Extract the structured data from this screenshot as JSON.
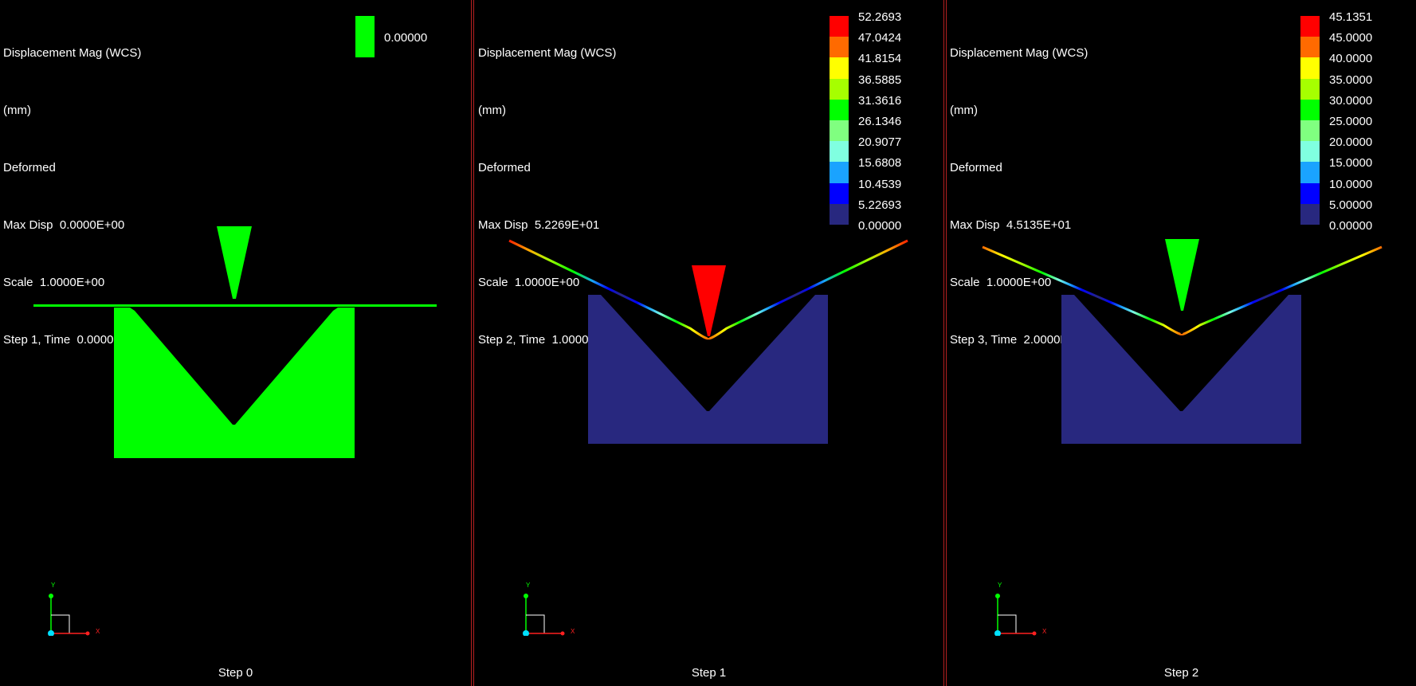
{
  "viewports": [
    {
      "info": [
        "Displacement Mag (WCS)",
        "(mm)",
        "Deformed",
        "Max Disp  0.0000E+00",
        "Scale  1.0000E+00",
        "Step 1, Time  0.0000E+00"
      ],
      "legend": {
        "single": true,
        "labels": [
          "0.00000"
        ],
        "colors": [
          "#00ff00",
          "#00ff00"
        ]
      },
      "step_label": "Step 0"
    },
    {
      "info": [
        "Displacement Mag (WCS)",
        "(mm)",
        "Deformed",
        "Max Disp  5.2269E+01",
        "Scale  1.0000E+00",
        "Step 2, Time  1.0000E+00"
      ],
      "legend": {
        "single": false,
        "labels": [
          "52.2693",
          "47.0424",
          "41.8154",
          "36.5885",
          "31.3616",
          "26.1346",
          "20.9077",
          "15.6808",
          "10.4539",
          "5.22693",
          "0.00000"
        ],
        "colors": [
          "#ff0000",
          "#ff6a00",
          "#ffff00",
          "#a6ff00",
          "#00ff00",
          "#80ff80",
          "#80ffe0",
          "#1aa3ff",
          "#0000ff",
          "#28287f"
        ]
      },
      "step_label": "Step 1"
    },
    {
      "info": [
        "Displacement Mag (WCS)",
        "(mm)",
        "Deformed",
        "Max Disp  4.5135E+01",
        "Scale  1.0000E+00",
        "Step 3, Time  2.0000E+00"
      ],
      "legend": {
        "single": false,
        "labels": [
          "45.1351",
          "45.0000",
          "40.0000",
          "35.0000",
          "30.0000",
          "25.0000",
          "20.0000",
          "15.0000",
          "10.0000",
          "5.00000",
          "0.00000"
        ],
        "colors": [
          "#ff0000",
          "#ff6a00",
          "#ffff00",
          "#a6ff00",
          "#00ff00",
          "#80ff80",
          "#80ffe0",
          "#1aa3ff",
          "#0000ff",
          "#28287f"
        ]
      },
      "step_label": "Step 2"
    }
  ],
  "axes": {
    "y_label": "Y",
    "x_label": "X"
  },
  "colors": {
    "die_blue": "#28287f",
    "green": "#00ff00",
    "red": "#ff0000",
    "divider": "#b52020"
  }
}
